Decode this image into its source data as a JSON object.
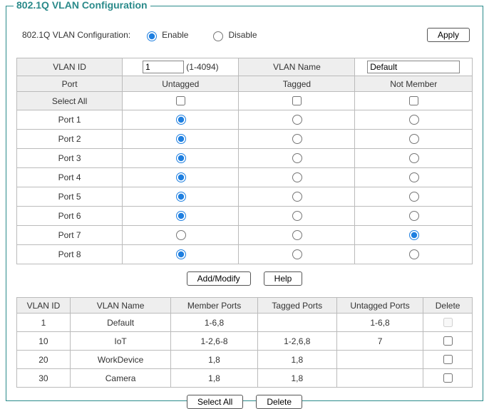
{
  "title": "802.1Q VLAN Configuration",
  "config": {
    "label": "802.1Q VLAN Configuration:",
    "enable_label": "Enable",
    "disable_label": "Disable",
    "apply_label": "Apply",
    "selected": "enable"
  },
  "port_table": {
    "headers": {
      "vlan_id": "VLAN ID",
      "vlan_name": "VLAN Name",
      "port": "Port",
      "untagged": "Untagged",
      "tagged": "Tagged",
      "not_member": "Not Member",
      "select_all": "Select All"
    },
    "vlan_id_value": "1",
    "vlan_id_hint": "(1-4094)",
    "vlan_name_value": "Default",
    "ports": [
      {
        "label": "Port 1",
        "sel": "untagged"
      },
      {
        "label": "Port 2",
        "sel": "untagged"
      },
      {
        "label": "Port 3",
        "sel": "untagged"
      },
      {
        "label": "Port 4",
        "sel": "untagged"
      },
      {
        "label": "Port 5",
        "sel": "untagged"
      },
      {
        "label": "Port 6",
        "sel": "untagged"
      },
      {
        "label": "Port 7",
        "sel": "not_member"
      },
      {
        "label": "Port 8",
        "sel": "untagged"
      }
    ]
  },
  "buttons": {
    "add_modify": "Add/Modify",
    "help": "Help",
    "select_all": "Select All",
    "delete": "Delete"
  },
  "vlan_list": {
    "headers": {
      "vlan_id": "VLAN ID",
      "vlan_name": "VLAN Name",
      "member_ports": "Member Ports",
      "tagged_ports": "Tagged Ports",
      "untagged_ports": "Untagged Ports",
      "delete": "Delete"
    },
    "rows": [
      {
        "id": "1",
        "name": "Default",
        "member": "1-6,8",
        "tagged": "",
        "untagged": "1-6,8",
        "deletable": false
      },
      {
        "id": "10",
        "name": "IoT",
        "member": "1-2,6-8",
        "tagged": "1-2,6,8",
        "untagged": "7",
        "deletable": true
      },
      {
        "id": "20",
        "name": "WorkDevice",
        "member": "1,8",
        "tagged": "1,8",
        "untagged": "",
        "deletable": true
      },
      {
        "id": "30",
        "name": "Camera",
        "member": "1,8",
        "tagged": "1,8",
        "untagged": "",
        "deletable": true
      }
    ]
  }
}
